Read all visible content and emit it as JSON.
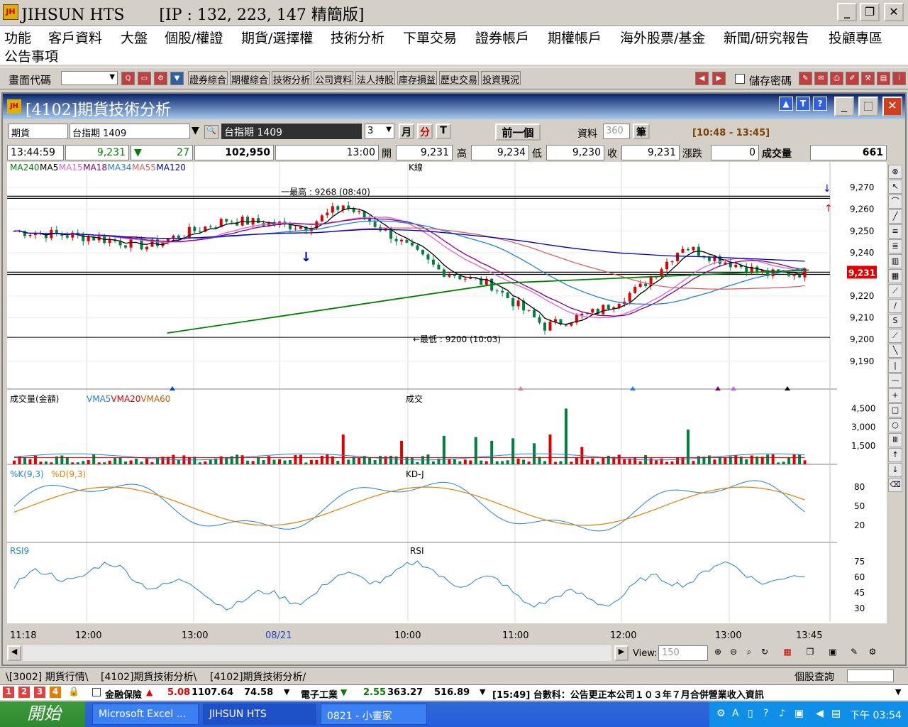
{
  "app": {
    "title": "JIHSUN HTS       [IP : 132, 223, 147 精簡版]",
    "icon": "jihsun-logo-icon"
  },
  "menu": [
    "功能",
    "客戶資料",
    "大盤",
    "個股/權證",
    "期貨/選擇權",
    "技術分析",
    "下單交易",
    "證券帳戶",
    "期權帳戶",
    "海外股票/基金",
    "新聞/研究報告",
    "投顧專區",
    "公告事項"
  ],
  "toolbar": {
    "code_label": "畫面代碼",
    "buttons": [
      "證券綜合",
      "期權綜合",
      "技術分析",
      "公司資料",
      "法人持股",
      "庫存損益",
      "歷史交易",
      "投資現況"
    ],
    "save_pwd": "儲存密碼"
  },
  "window": {
    "title": "[4102]期貨技術分析",
    "help_icons": [
      "▲",
      "T",
      "?"
    ]
  },
  "controls": {
    "type": "期貨",
    "symbol": "台指期 1409",
    "symbol_display": "台指期  1409",
    "period": "3",
    "btn_month": "月",
    "btn_min": "分",
    "btn_t": "T",
    "prev": "前一個",
    "data_label": "資料",
    "data_count": "360",
    "unit": "筆",
    "range": "[10:48 - 13:45]"
  },
  "quote": {
    "time": "13:44:59",
    "price": "9,231",
    "change": "27",
    "volume_total": "102,950",
    "t": "13:00",
    "open_label": "開",
    "open": "9,231",
    "high_label": "高",
    "high": "9,234",
    "low_label": "低",
    "low": "9,230",
    "close_label": "收",
    "close": "9,231",
    "updown_label": "漲跌",
    "updown": "0",
    "vol_label": "成交量",
    "vol": "661"
  },
  "kline": {
    "title": "K線",
    "legend": [
      "MA240",
      "MA5",
      "MA15",
      "MA18",
      "MA34",
      "MA55",
      "MA120"
    ],
    "legend_colors": [
      "#008000",
      "#000000",
      "#e060e0",
      "#800080",
      "#2080e0",
      "#e06060",
      "#0000c0"
    ],
    "high_note": "一最高 : 9268 (08:40)",
    "low_note": "←最低 : 9200 (10:03)",
    "current": "9,231",
    "ticks": [
      "9,270",
      "9,260",
      "9,250",
      "9,240",
      "9,220",
      "9,210",
      "9,200",
      "9,190"
    ]
  },
  "volume": {
    "title": "成交",
    "legend": "成交量(金額)",
    "vma": [
      "VMA5",
      "VMA20",
      "VMA60"
    ],
    "vma_colors": [
      "#2080e0",
      "#e00000",
      "#c06000"
    ],
    "ticks": [
      "4,500",
      "3,000",
      "1,500"
    ]
  },
  "kd": {
    "title": "KD-J",
    "k": "%K(9,3)",
    "d": "%D(9,3)",
    "ticks": [
      "80",
      "50",
      "20"
    ]
  },
  "rsi": {
    "title": "RSI",
    "legend": "RSI9",
    "ticks": [
      "75",
      "60",
      "45",
      "30"
    ]
  },
  "xaxis": [
    "11:18",
    "12:00",
    "13:00",
    "08/21",
    "10:00",
    "11:00",
    "12:00",
    "13:00",
    "13:45"
  ],
  "view": {
    "label": "View:",
    "value": "150"
  },
  "tabs": [
    "\\[3002] 期貨行情\\",
    "[4102]期貨技術分析\\",
    "[4102]期貨技術分析/"
  ],
  "stock_query": "個股查詢",
  "ticker": {
    "nums": [
      "1",
      "2",
      "3",
      "4"
    ],
    "item1": "金融保險",
    "item1_chg": "5.08",
    "item1_val": "1107.64",
    "item1_vol": "74.58",
    "item2": "電子工業",
    "item2_chg": "2.55",
    "item2_val": "363.27",
    "item2_vol": "516.89",
    "news": "[15:49] 台數科：公告更正本公司１０３年７月合併營業收入資訊"
  },
  "taskbar": {
    "start": "開始",
    "items": [
      "Microsoft Excel ...",
      "JIHSUN HTS",
      "0821 - 小畫家"
    ],
    "clock": "下午 03:54"
  }
}
